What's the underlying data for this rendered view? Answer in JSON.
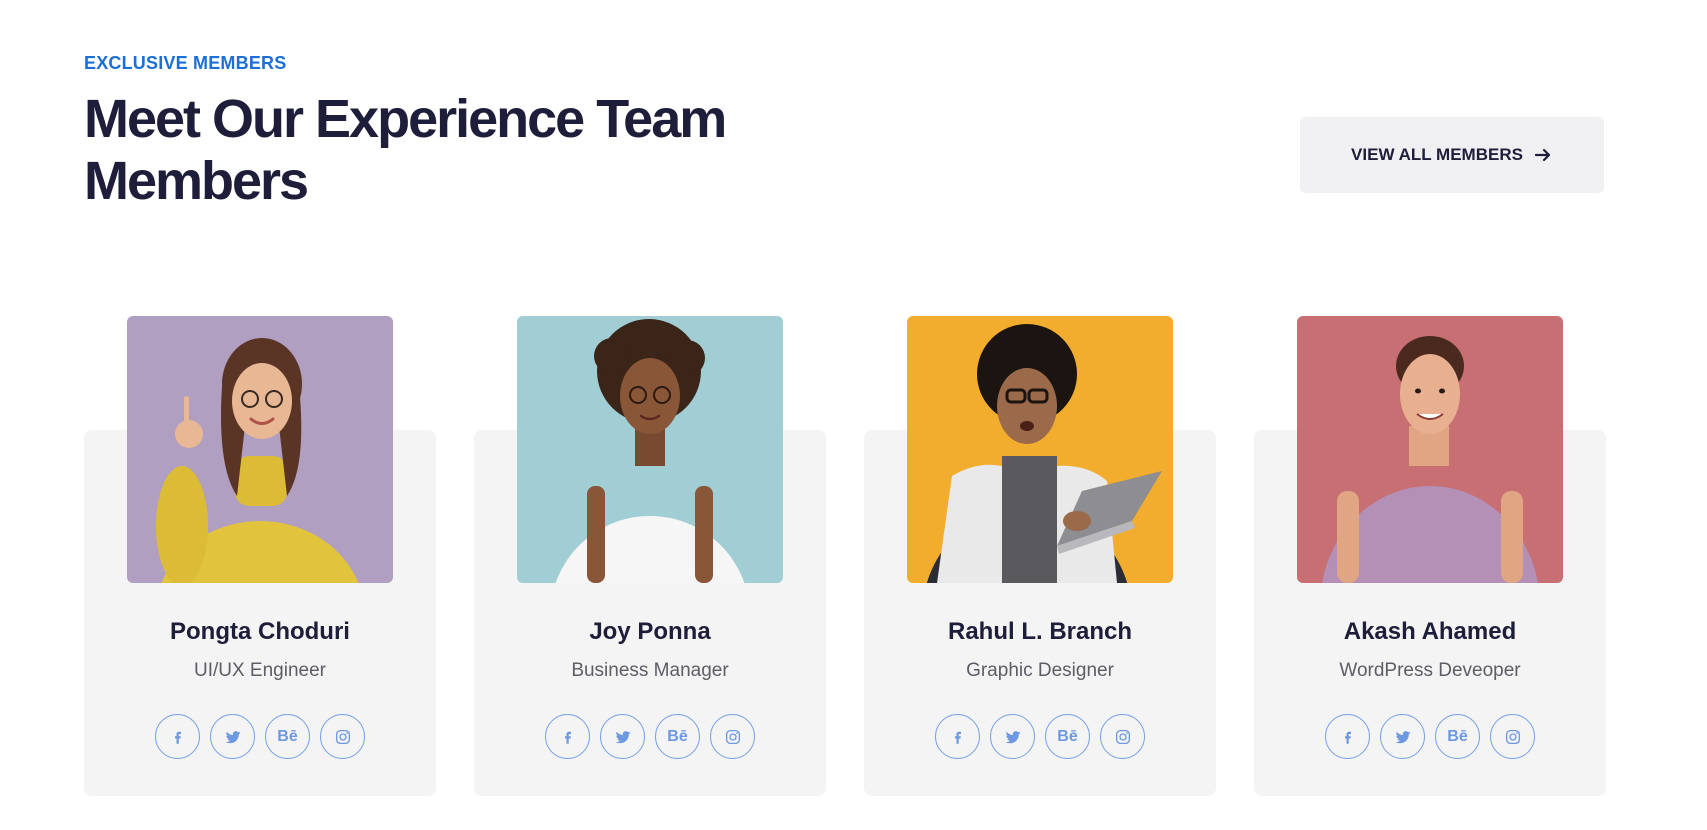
{
  "header": {
    "eyebrow": "EXCLUSIVE MEMBERS",
    "title": "Meet Our Experience Team Members",
    "view_all_label": "VIEW ALL MEMBERS",
    "view_all_icon": "arrow-right-icon"
  },
  "colors": {
    "accent": "#1b6fd6",
    "heading": "#1e1d3a",
    "card_bg": "#f4f4f4",
    "social_border": "#7aa3e5"
  },
  "social_icons": [
    "facebook-icon",
    "twitter-icon",
    "behance-icon",
    "instagram-icon"
  ],
  "members": [
    {
      "name": "Pongta Choduri",
      "role": "UI/UX Engineer",
      "photo_bg": "#b19fc2"
    },
    {
      "name": "Joy Ponna",
      "role": "Business Manager",
      "photo_bg": "#a9d4da"
    },
    {
      "name": "Rahul L. Branch",
      "role": "Graphic Designer",
      "photo_bg": "#f3ad2e"
    },
    {
      "name": "Akash Ahamed",
      "role": "WordPress Deveoper",
      "photo_bg": "#c86f73"
    }
  ]
}
